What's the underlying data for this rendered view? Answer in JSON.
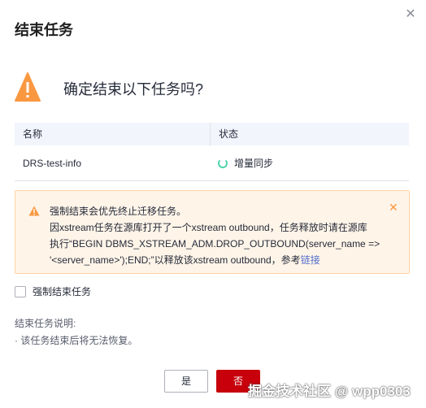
{
  "dialog": {
    "title": "结束任务",
    "question": "确定结束以下任务吗?",
    "table": {
      "headers": [
        "名称",
        "状态"
      ],
      "rows": [
        {
          "name": "DRS-test-info",
          "status": "增量同步"
        }
      ]
    },
    "alert": {
      "line1": "强制结束会优先终止迁移任务。",
      "line2": "因xstream任务在源库打开了一个xstream outbound，任务释放时请在源库",
      "line3": "执行“BEGIN DBMS_XSTREAM_ADM.DROP_OUTBOUND(server_name =>",
      "line4_prefix": "'<server_name>');END;”以释放该xstream outbound，参考",
      "link": "链接"
    },
    "checkbox_label": "强制结束任务",
    "note_title": "结束任务说明:",
    "note_item": "· 该任务结束后将无法恢复。",
    "buttons": {
      "yes": "是",
      "no": "否"
    }
  },
  "watermark": "掘金技术社区 @ wpp0303",
  "colors": {
    "primary_button": "#c7000b",
    "warning": "#fa9841",
    "alert_bg": "#fff4e8",
    "link": "#526ecc",
    "status_spinner": "#50d4ab"
  },
  "icons": {
    "close": "close-icon",
    "warning_large": "warning-triangle-icon",
    "warning_small": "warning-triangle-icon",
    "status": "spinner-icon"
  }
}
